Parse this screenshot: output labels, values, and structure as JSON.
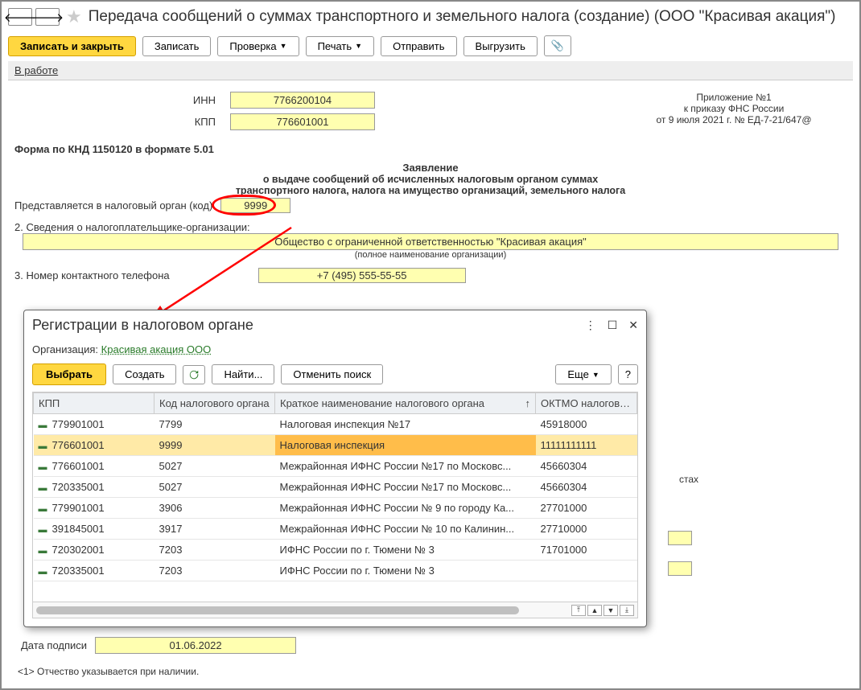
{
  "title": "Передача сообщений о суммах транспортного и земельного налога (создание) (ООО \"Красивая акация\")",
  "toolbar": {
    "save_close": "Записать и закрыть",
    "save": "Записать",
    "check": "Проверка",
    "print": "Печать",
    "send": "Отправить",
    "export": "Выгрузить"
  },
  "tab": "В работе",
  "form": {
    "inn_label": "ИНН",
    "inn": "7766200104",
    "kpp_label": "КПП",
    "kpp": "776601001",
    "right_lines": [
      "Приложение №1",
      "к приказу ФНС России",
      "от 9 июля 2021 г. № ЕД-7-21/647@"
    ],
    "caption": "Форма по КНД 1150120 в формате 5.01",
    "heading": "Заявление",
    "sub1": "о выдаче сообщений об исчисленных налоговым органом суммах",
    "sub2": "транспортного налога, налога на имущество организаций, земельного налога",
    "presented_label": "Представляется в налоговый орган (код)",
    "presented_code": "9999",
    "sec2_label": "2. Сведения о налогоплательщике-организации:",
    "org_full": "Общество с ограниченной ответственностью \"Красивая акация\"",
    "org_caption": "(полное наименование организации)",
    "sec3_label": "3. Номер контактного телефона",
    "phone": "+7 (495) 555-55-55"
  },
  "stakh": "стах",
  "popup": {
    "title": "Регистрации в налоговом органе",
    "org_label": "Организация:",
    "org_value": "Красивая акация ООО",
    "select": "Выбрать",
    "create": "Создать",
    "find": "Найти...",
    "cancel_find": "Отменить поиск",
    "more": "Еще",
    "help": "?",
    "columns": [
      "КПП",
      "Код налогового органа",
      "Краткое наименование налогового органа",
      "ОКТМО налогово..."
    ],
    "rows": [
      {
        "kpp": "779901001",
        "code": "7799",
        "name": "Налоговая инспекция №17",
        "oktmo": "45918000"
      },
      {
        "kpp": "776601001",
        "code": "9999",
        "name": "Налоговая инспекция",
        "oktmo": "11111111111"
      },
      {
        "kpp": "776601001",
        "code": "5027",
        "name": "Межрайонная ИФНС России №17 по Московс...",
        "oktmo": "45660304"
      },
      {
        "kpp": "720335001",
        "code": "5027",
        "name": "Межрайонная ИФНС России №17 по Московс...",
        "oktmo": "45660304"
      },
      {
        "kpp": "779901001",
        "code": "3906",
        "name": "Межрайонная ИФНС России № 9 по городу Ка...",
        "oktmo": "27701000"
      },
      {
        "kpp": "391845001",
        "code": "3917",
        "name": "Межрайонная ИФНС России № 10 по Калинин...",
        "oktmo": "27710000"
      },
      {
        "kpp": "720302001",
        "code": "7203",
        "name": "ИФНС России по г. Тюмени № 3",
        "oktmo": "71701000"
      },
      {
        "kpp": "720335001",
        "code": "7203",
        "name": "ИФНС России по г. Тюмени № 3",
        "oktmo": ""
      }
    ],
    "selected_index": 1
  },
  "footer": {
    "date_label": "Дата подписи",
    "date": "01.06.2022",
    "footnote": "<1> Отчество указывается при наличии."
  }
}
